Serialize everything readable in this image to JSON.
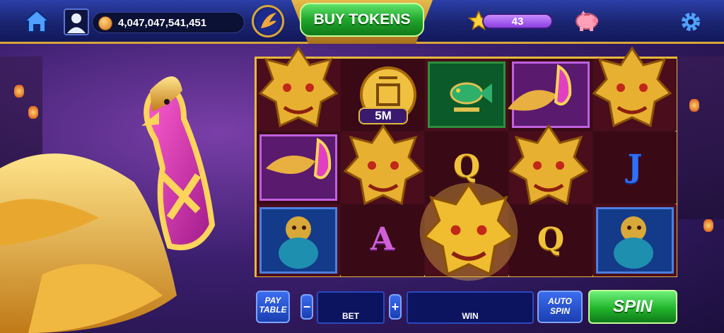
{
  "header": {
    "coins": "4,047,047,541,451",
    "buy_label": "BUY TOKENS",
    "level": "43"
  },
  "reels": {
    "coin_value": "5M",
    "symbols": [
      [
        "dragon",
        "coin",
        "phoenix",
        "phoenix"
      ],
      [
        "dragon",
        "dragon",
        "dragon",
        "lion"
      ],
      [
        "coin",
        "dragon",
        "Q",
        "A"
      ],
      [
        "fish",
        "Q",
        "dragon",
        "Q"
      ],
      [
        "phoenix",
        "dragon",
        "J",
        "lion"
      ]
    ]
  },
  "controls": {
    "paytable_label_1": "PAY",
    "paytable_label_2": "TABLE",
    "minus_label": "−",
    "plus_label": "+",
    "bet_label": "BET",
    "win_label": "WIN",
    "autospin_label_1": "AUTO",
    "autospin_label_2": "SPIN",
    "spin_label": "SPIN"
  },
  "letters": {
    "q": "Q",
    "j": "J",
    "a": "A"
  },
  "icons": {
    "home": "home-icon",
    "avatar": "avatar-icon",
    "coin": "coin-icon",
    "phoenix_badge": "phoenix-badge-icon",
    "star": "star-icon",
    "piggy": "piggy-bank-icon",
    "settings": "gear-icon"
  },
  "colors": {
    "accent_gold": "#e8b83c",
    "buy_green": "#20a52c",
    "spin_green": "#22b52c",
    "level_purple": "#8a3fe0"
  }
}
